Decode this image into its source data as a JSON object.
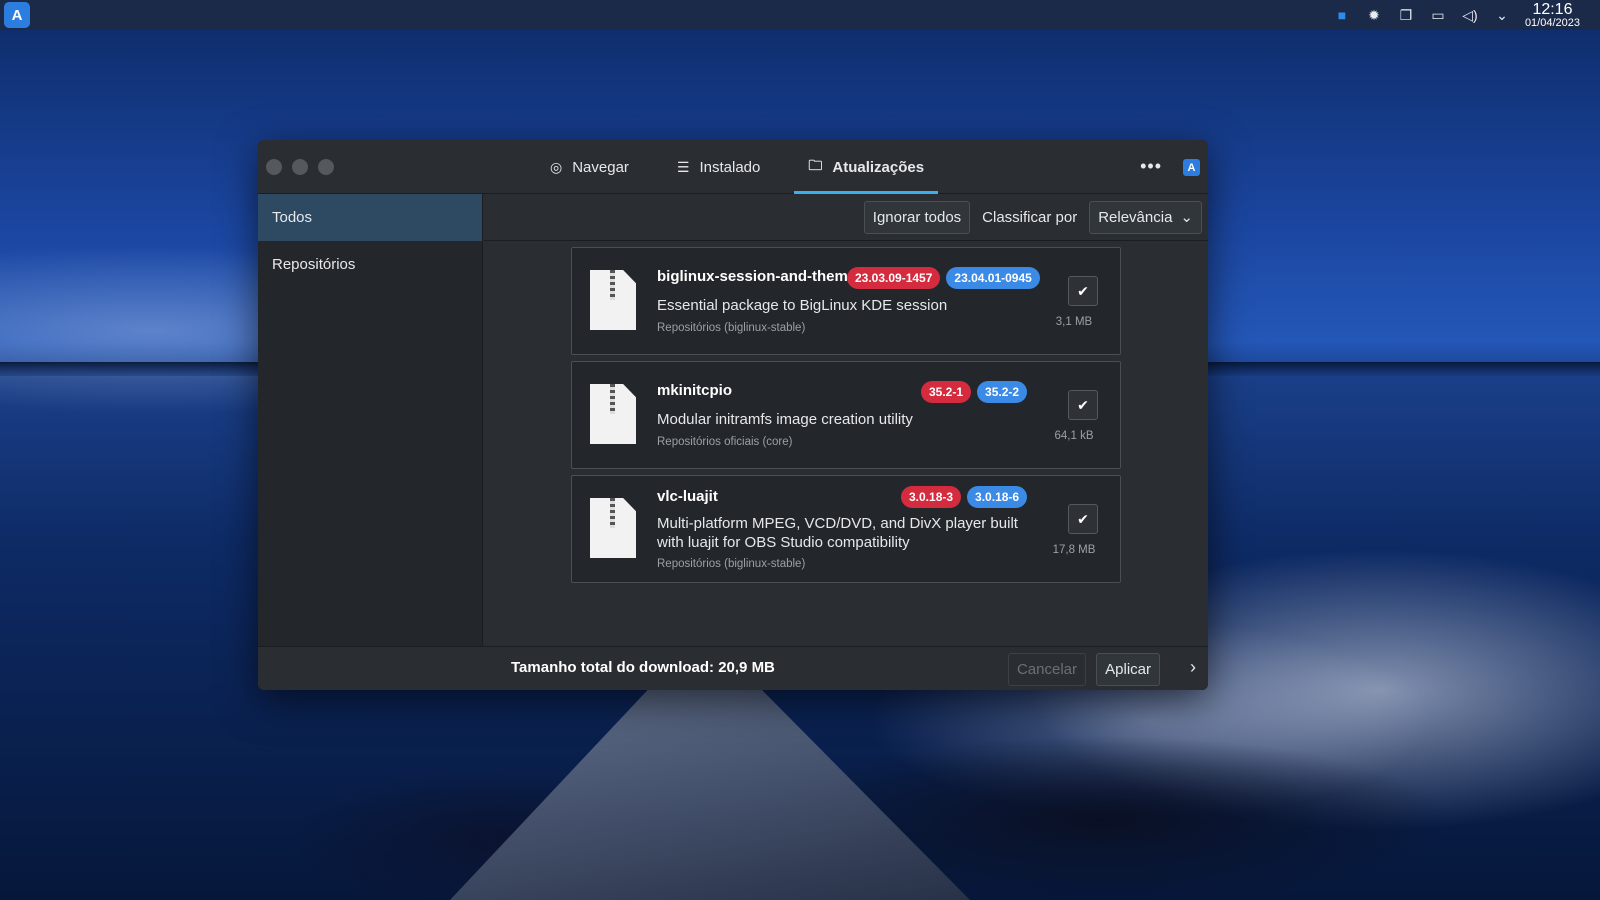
{
  "panel": {
    "launcher_icon": "app-store-icon",
    "tray_icons": [
      "teams-icon",
      "settings-icon",
      "clipboard-icon",
      "display-icon",
      "volume-icon",
      "chevron-down-icon"
    ],
    "time": "12:16",
    "date": "01/04/2023"
  },
  "window": {
    "tabs": [
      {
        "label": "Navegar",
        "icon": "globe-icon"
      },
      {
        "label": "Instalado",
        "icon": "list-icon"
      },
      {
        "label": "Atualizações",
        "icon": "folder-update-icon"
      }
    ],
    "active_tab": "Atualizações",
    "menu_label": "•••",
    "app_badge": "A"
  },
  "sidebar": {
    "items": [
      {
        "label": "Todos"
      },
      {
        "label": "Repositórios"
      }
    ],
    "selected": "Todos"
  },
  "toolbar": {
    "ignore_all": "Ignorar todos",
    "sort_label": "Classificar por",
    "sort_value": "Relevância"
  },
  "packages": [
    {
      "name": "biglinux-session-and-themes",
      "old_version": "23.03.09-1457",
      "new_version": "23.04.01-0945",
      "description": "Essential package to BigLinux KDE session",
      "repo": "Repositórios (biglinux-stable)",
      "size": "3,1 MB",
      "checked": true
    },
    {
      "name": "mkinitcpio",
      "old_version": "35.2-1",
      "new_version": "35.2-2",
      "description": "Modular initramfs image creation utility",
      "repo": "Repositórios oficiais (core)",
      "size": "64,1 kB",
      "checked": true
    },
    {
      "name": "vlc-luajit",
      "old_version": "3.0.18-3",
      "new_version": "3.0.18-6",
      "description": "Multi-platform MPEG, VCD/DVD, and DivX player built with luajit for OBS Studio compatibility",
      "repo": "Repositórios (biglinux-stable)",
      "size": "17,8 MB",
      "checked": true
    }
  ],
  "footer": {
    "total": "Tamanho total do download: 20,9 MB",
    "cancel": "Cancelar",
    "apply": "Aplicar"
  },
  "colors": {
    "accent": "#3daee9",
    "old_version": "#d52b3e",
    "new_version": "#3a8ae6",
    "sidebar_selected": "#2e4a63"
  }
}
